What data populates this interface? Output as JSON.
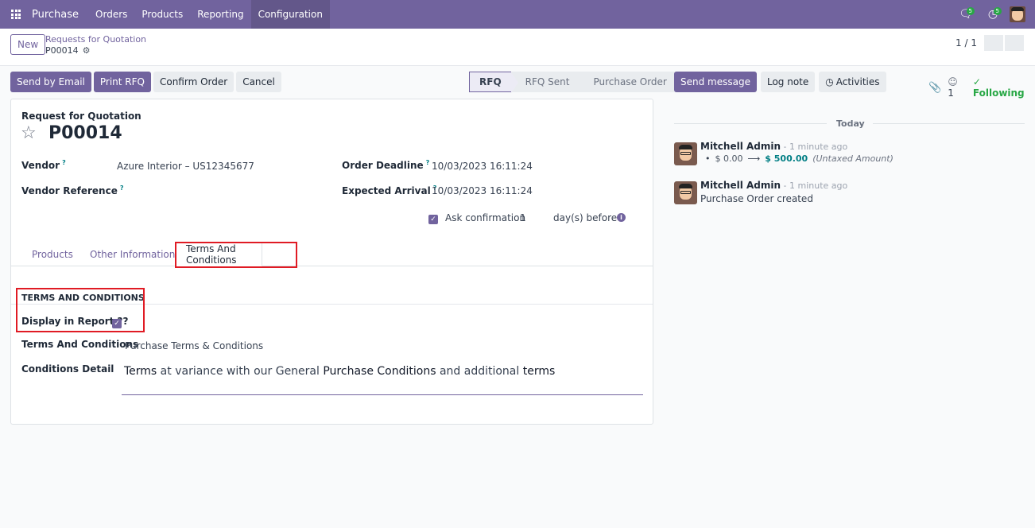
{
  "nav": {
    "app_name": "Purchase",
    "menu": [
      "Orders",
      "Products",
      "Reporting",
      "Configuration"
    ],
    "active_menu": "Configuration",
    "messages_badge": "5",
    "activities_badge": "5"
  },
  "control_panel": {
    "new_label": "New",
    "breadcrumb_parent": "Requests for Quotation",
    "breadcrumb_current": "P00014",
    "pager": "1 / 1"
  },
  "actions": {
    "send_email": "Send by Email",
    "print_rfq": "Print RFQ",
    "confirm": "Confirm Order",
    "cancel": "Cancel"
  },
  "status": {
    "stages": [
      "RFQ",
      "RFQ Sent",
      "Purchase Order"
    ],
    "current": "RFQ"
  },
  "form": {
    "doc_type": "Request for Quotation",
    "name": "P00014",
    "vendor_label": "Vendor",
    "vendor_value": "Azure Interior – US12345677",
    "vendor_ref_label": "Vendor Reference",
    "vendor_ref_value": "",
    "deadline_label": "Order Deadline",
    "deadline_value": "10/03/2023 16:11:24",
    "arrival_label": "Expected Arrival",
    "arrival_value": "10/03/2023 16:11:24",
    "ask_confirm_label": "Ask confirmation",
    "ask_confirm_days": "1",
    "ask_confirm_suffix": "day(s) before",
    "tooltip_marker": "?",
    "tabs": [
      "Products",
      "Other Information",
      "Terms And Conditions"
    ],
    "active_tab": "Terms And Conditions",
    "section_title": "TERMS AND CONDITIONS",
    "display_report_label": "Display in Report ??",
    "display_report_checked": true,
    "terms_label": "Terms And Conditions",
    "terms_value": "Purchase Terms & Conditions",
    "conditions_label": "Conditions Detail",
    "conditions_text": {
      "w1": "Terms",
      "w2": " at variance with our General ",
      "w3": "Purchase Conditions",
      "w4": " and additional ",
      "w5": "terms"
    }
  },
  "chatter": {
    "send_message": "Send message",
    "log_note": "Log note",
    "activities": "Activities",
    "followers_count": "1",
    "following": "Following",
    "date_separator": "Today",
    "messages": [
      {
        "author": "Mitchell Admin",
        "ago": " - 1 minute ago",
        "old_value": "$ 0.00",
        "new_value": "$ 500.00",
        "field": "(Untaxed Amount)"
      },
      {
        "author": "Mitchell Admin",
        "ago": " - 1 minute ago",
        "body": "Purchase Order created"
      }
    ]
  },
  "colors": {
    "brand": "#71639e",
    "highlight_box": "#e01b24",
    "following": "#28a745",
    "tracking_new": "#017e84"
  },
  "icons": [
    "apps-grid-icon",
    "chat-icon",
    "clock-icon",
    "gear-icon",
    "star-icon",
    "info-icon",
    "paperclip-icon",
    "user-icon",
    "check-icon",
    "arrow-right-icon"
  ]
}
